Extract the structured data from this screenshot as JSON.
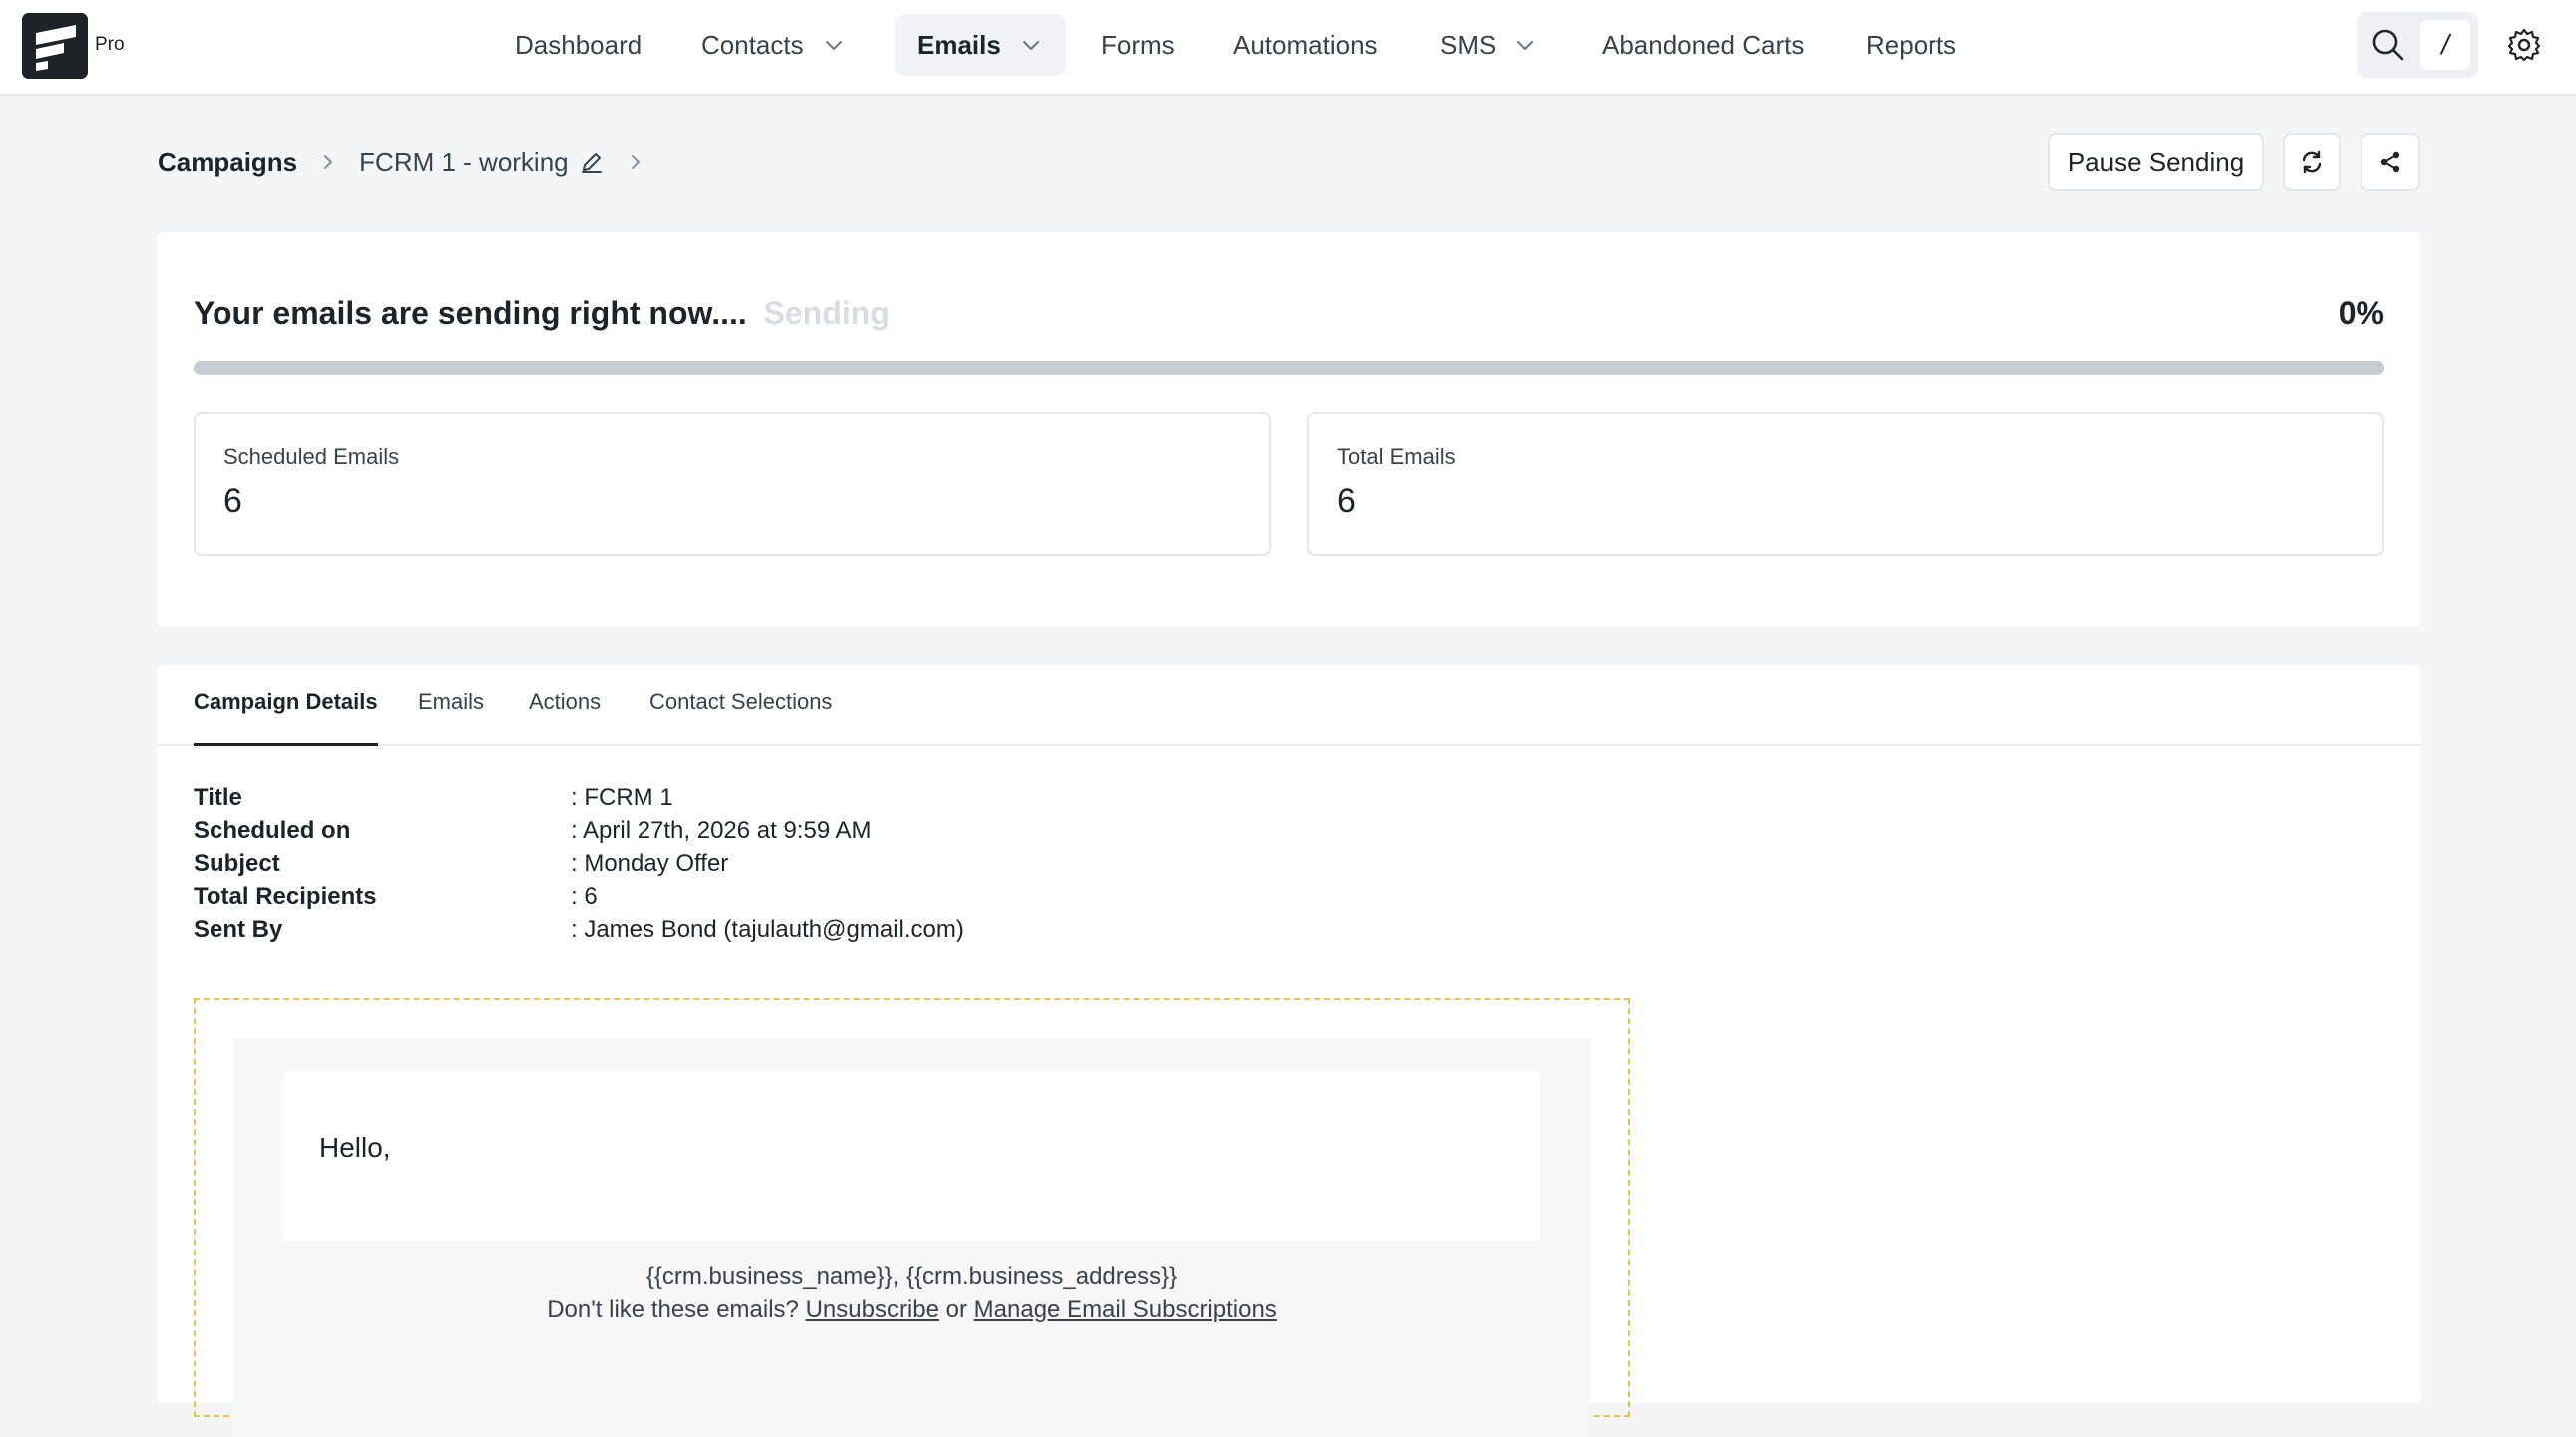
{
  "logo": {
    "badge": "Pro"
  },
  "nav": {
    "items": [
      {
        "label": "Dashboard"
      },
      {
        "label": "Contacts"
      },
      {
        "label": "Emails"
      },
      {
        "label": "Forms"
      },
      {
        "label": "Automations"
      },
      {
        "label": "SMS"
      },
      {
        "label": "Abandoned Carts"
      },
      {
        "label": "Reports"
      }
    ],
    "search_shortcut": "/"
  },
  "breadcrumb": {
    "root": "Campaigns",
    "current": "FCRM 1 - working"
  },
  "actions": {
    "pause_label": "Pause Sending"
  },
  "progress": {
    "title": "Your emails are sending right now....",
    "status_faded": "Sending",
    "percent_label": "0%",
    "percent_value": 0
  },
  "stats": {
    "scheduled": {
      "label": "Scheduled Emails",
      "value": "6"
    },
    "total": {
      "label": "Total Emails",
      "value": "6"
    }
  },
  "tabs": [
    {
      "label": "Campaign Details"
    },
    {
      "label": "Emails"
    },
    {
      "label": "Actions"
    },
    {
      "label": "Contact Selections"
    }
  ],
  "details": [
    {
      "label": "Title",
      "value": ": FCRM 1"
    },
    {
      "label": "Scheduled on",
      "value": ": April 27th, 2026 at 9:59 AM"
    },
    {
      "label": "Subject",
      "value": ": Monday Offer"
    },
    {
      "label": "Total Recipients",
      "value": ": 6"
    },
    {
      "label": "Sent By",
      "value": ": James Bond (tajulauth@gmail.com)"
    }
  ],
  "preview": {
    "greeting": "Hello,",
    "business_line": "{{crm.business_name}}, {{crm.business_address}}",
    "dislike_text": "Don't like these emails?",
    "unsubscribe": "Unsubscribe",
    "or_text": "or",
    "manage": "Manage Email Subscriptions"
  },
  "colors": {
    "accent": "#1d2327",
    "progress_track": "#c7ccd3",
    "preview_border": "#e2c64a",
    "page_bg": "#f4f5f7"
  }
}
